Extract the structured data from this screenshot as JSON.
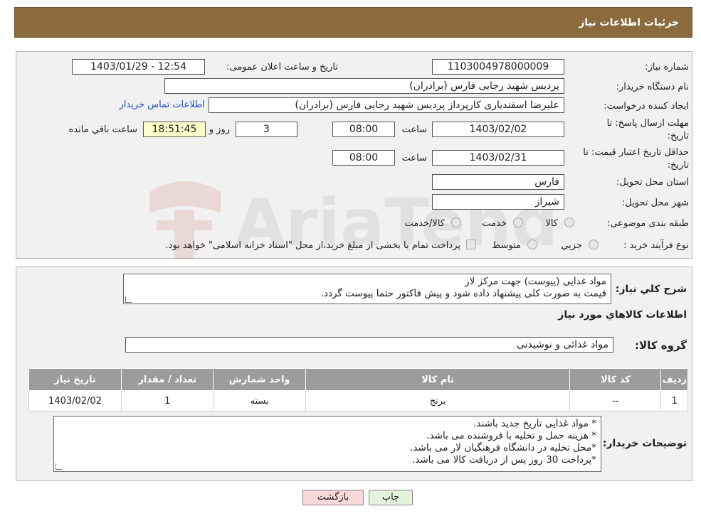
{
  "header": {
    "title": "جزئیات اطلاعات نیاز"
  },
  "watermark": {
    "text": "AriaTender.neT"
  },
  "fields": {
    "need_number": {
      "label": "شماره نیاز:",
      "value": "1103004978000009"
    },
    "announce_datetime": {
      "label": "تاریخ و ساعت اعلان عمومی:",
      "value": "1403/01/29 - 12:54"
    },
    "buyer_org": {
      "label": "نام دستگاه خریدار:",
      "value": "پردیس شهید رجایی فارس (برادران)"
    },
    "requester": {
      "label": "ایجاد کننده درخواست:",
      "value": "علیرضا اسفندیاری کارپرداز پردیس شهید رجایی فارس (برادران)",
      "contact_link": "اطلاعات تماس خریدار"
    },
    "reply_deadline": {
      "label_line1": "مهلت ارسال پاسخ: تا",
      "label_line2": "تاریخ:",
      "date": "1403/02/02",
      "time_label": "ساعت",
      "time": "08:00",
      "days": "3",
      "days_label": "روز و",
      "remaining_time": "18:51:45",
      "remaining_label": "ساعت باقي مانده"
    },
    "price_validity": {
      "label_line1": "حداقل تاریخ اعتبار قیمت: تا",
      "label_line2": "تاریخ:",
      "date": "1403/02/31",
      "time_label": "ساعت",
      "time": "08:00"
    },
    "province": {
      "label": "استان محل تحویل:",
      "value": "فارس"
    },
    "city": {
      "label": "شهر محل تحویل:",
      "value": "شیراز"
    },
    "category": {
      "label": "طبقه بندی موضوعی:",
      "options": [
        "کالا",
        "خدمت",
        "کالا/خدمت"
      ]
    },
    "purchase_type": {
      "label": "نوع فرآیند خرید :",
      "options": [
        "جزیي",
        "متوسط"
      ],
      "note": "پرداخت تمام یا بخشی از مبلغ خرید،از محل \"اسناد خزانه اسلامی\" خواهد بود."
    }
  },
  "description": {
    "label": "شرح کلي نياز:",
    "line1": "مواد غذایی (پیوست) جهت مرکز لار",
    "line2": "قیمت به صورت کلی پیشنهاد داده شود و پیش فاکتور حتما پیوست گردد."
  },
  "goods_section": {
    "title": "اطلاعات کالاهاي مورد نياز",
    "group_label": "گروه کالا:",
    "group_value": "مواد غذائی و نوشیدنی",
    "columns": [
      "رديف",
      "کد کالا",
      "نام کالا",
      "واحد شمارش",
      "تعداد / مقدار",
      "تاریخ نیاز"
    ],
    "rows": [
      {
        "row": "1",
        "code": "--",
        "name": "برنج",
        "unit": "بسته",
        "qty": "1",
        "date": "1403/02/02"
      }
    ]
  },
  "buyer_notes": {
    "label": "توضیحات خریدار:",
    "line1": "* مواد غذایی تاریخ جدید باشند.",
    "line2": "* هزینه حمل و تخلیه با فروشنده می باشد.",
    "line3": "*محل تخلیه در دانشگاه فرهنگیان لار می باشد.",
    "line4": "*پرداخت 30 روز پس از دریافت کالا می باشد."
  },
  "buttons": {
    "print": "چاپ",
    "back": "بازگشت"
  },
  "colors": {
    "header_bg": "#8b6a3e",
    "panel_bg": "#f1f1f1",
    "field_yellow": "#ffffcc",
    "link": "#1f4fd0",
    "back_button_bg": "#f8d8d8",
    "print_button_bg": "#e4f4dc"
  }
}
